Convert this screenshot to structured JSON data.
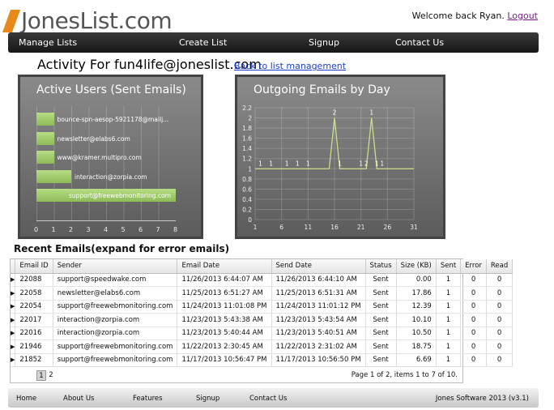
{
  "header": {
    "logo_text": "JonesList.com",
    "welcome_text": "Welcome back Ryan.",
    "logout_label": "Logout"
  },
  "nav": {
    "items": [
      "Manage Lists",
      "Create List",
      "Signup",
      "Contact Us"
    ]
  },
  "activity": {
    "title": "Activity For fun4life@joneslist.com",
    "back_link": "Back to list management"
  },
  "chart_data": [
    {
      "type": "bar",
      "orientation": "horizontal",
      "title": "Active Users (Sent Emails)",
      "categories": [
        "bounce-spn-aesop-5921178@mailj...",
        "newsletter@elabs6.com",
        "www@kramer.multipro.com",
        "interaction@zorpia.com",
        "support@freewebmonitoring.com"
      ],
      "values": [
        1,
        1,
        1,
        2,
        8
      ],
      "xlim": [
        0,
        8
      ],
      "xticks": [
        "0",
        "1",
        "2",
        "3",
        "4",
        "5",
        "6",
        "7",
        "8"
      ],
      "grid": true
    },
    {
      "type": "line",
      "title": "Outgoing Emails by Day",
      "x": [
        1,
        2,
        3,
        4,
        5,
        6,
        7,
        8,
        9,
        10,
        11,
        12,
        13,
        14,
        15,
        16,
        17,
        18,
        19,
        20,
        21,
        22,
        23,
        24,
        25,
        26,
        27,
        28,
        29,
        30,
        31
      ],
      "values": [
        1,
        1,
        1,
        1,
        1,
        1,
        1,
        1,
        1,
        1,
        1,
        1,
        1,
        1,
        1,
        2,
        1,
        1,
        1,
        1,
        1,
        1,
        2,
        1,
        1,
        1,
        1,
        1,
        1,
        1,
        1
      ],
      "point_labels": [
        {
          "x": 2,
          "text": "1"
        },
        {
          "x": 4,
          "text": "1"
        },
        {
          "x": 7,
          "text": "1"
        },
        {
          "x": 9,
          "text": "1"
        },
        {
          "x": 11,
          "text": "1"
        },
        {
          "x": 16,
          "text": "2"
        },
        {
          "x": 17,
          "text": "1"
        },
        {
          "x": 21,
          "text": "1"
        },
        {
          "x": 22,
          "text": "2"
        },
        {
          "x": 23,
          "text": "1"
        },
        {
          "x": 24,
          "text": "1"
        },
        {
          "x": 25,
          "text": "1"
        }
      ],
      "ylim": [
        0,
        2.2
      ],
      "yticks": [
        "0",
        "0.2",
        "0.4",
        "0.6",
        "0.8",
        "1",
        "1.2",
        "1.4",
        "1.6",
        "1.8",
        "2",
        "2.2"
      ],
      "xticks": [
        "1",
        "6",
        "11",
        "16",
        "21",
        "26",
        "31"
      ],
      "grid": true,
      "line_color": "#c9e08a"
    }
  ],
  "emails": {
    "section_title": "Recent Emails(expand for error emails)",
    "columns": [
      "Email ID",
      "Sender",
      "Email Date",
      "Send Date",
      "Status",
      "Size (KB)",
      "Sent",
      "Error",
      "Read"
    ],
    "rows": [
      [
        "22088",
        "support@speedwake.com",
        "11/26/2013 6:44:07 AM",
        "11/26/2013 6:44:10 AM",
        "Sent",
        "0.00",
        "1",
        "0",
        "0"
      ],
      [
        "22058",
        "newsletter@elabs6.com",
        "11/25/2013 6:51:27 AM",
        "11/25/2013 6:51:31 AM",
        "Sent",
        "17.86",
        "1",
        "0",
        "0"
      ],
      [
        "22054",
        "support@freewebmonitoring.com",
        "11/24/2013 11:01:08 PM",
        "11/24/2013 11:01:12 PM",
        "Sent",
        "12.39",
        "1",
        "0",
        "0"
      ],
      [
        "22017",
        "interaction@zorpia.com",
        "11/23/2013 5:43:38 AM",
        "11/23/2013 5:43:54 AM",
        "Sent",
        "10.10",
        "1",
        "0",
        "0"
      ],
      [
        "22016",
        "interaction@zorpia.com",
        "11/23/2013 5:40:44 AM",
        "11/23/2013 5:40:51 AM",
        "Sent",
        "10.50",
        "1",
        "0",
        "0"
      ],
      [
        "21946",
        "support@freewebmonitoring.com",
        "11/22/2013 2:30:45 AM",
        "11/22/2013 2:31:02 AM",
        "Sent",
        "18.75",
        "1",
        "0",
        "0"
      ],
      [
        "21852",
        "support@freewebmonitoring.com",
        "11/17/2013 10:56:47 PM",
        "11/17/2013 10:56:50 PM",
        "Sent",
        "6.69",
        "1",
        "0",
        "0"
      ]
    ],
    "pages": [
      "1",
      "2"
    ],
    "current_page": "1",
    "pager_info": "Page 1 of 2, items 1 to 7 of 10."
  },
  "footer": {
    "links": [
      "Home",
      "About Us",
      "Features",
      "Signup",
      "Contact Us"
    ],
    "copyright": "Jones Software 2013 (v3.1)"
  },
  "colors": {
    "logo_accent": "#e88a1a",
    "nav_bg": "#1f1f1f",
    "bar_fill": "#9ccb66",
    "link": "#1a3fcf"
  }
}
